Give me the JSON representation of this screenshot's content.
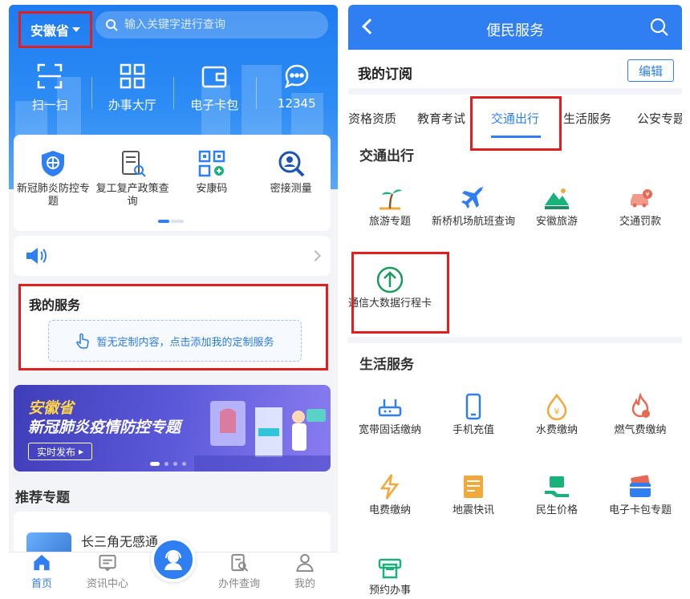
{
  "left": {
    "province": "安徽省",
    "search_placeholder": "输入关键字进行查询",
    "quick_actions": [
      {
        "label": "扫一扫",
        "icon": "scan-icon"
      },
      {
        "label": "办事大厅",
        "icon": "grid-icon"
      },
      {
        "label": "电子卡包",
        "icon": "wallet-icon"
      },
      {
        "label": "12345",
        "icon": "chat-icon"
      }
    ],
    "services": [
      {
        "label": "新冠肺炎防控专题",
        "icon": "shield-icon"
      },
      {
        "label": "复工复产政策查询",
        "icon": "document-icon"
      },
      {
        "label": "安康码",
        "icon": "qrcode-icon"
      },
      {
        "label": "密接测量",
        "icon": "magnifier-icon"
      }
    ],
    "my_service_title": "我的服务",
    "my_service_empty": "暂无定制内容，点击添加我的定制服务",
    "banner_line1": "安徽省",
    "banner_line2": "新冠肺炎疫情防控专题",
    "banner_button": "实时发布",
    "recommend_title": "推荐专题",
    "recommend_item": "长三角无感通",
    "tabs": [
      {
        "label": "首页",
        "active": true
      },
      {
        "label": "资讯中心",
        "active": false
      },
      {
        "label": "",
        "active": false
      },
      {
        "label": "办件查询",
        "active": false
      },
      {
        "label": "我的",
        "active": false
      }
    ],
    "colors": {
      "primary": "#2f7ff2",
      "highlight": "#e02020"
    }
  },
  "right": {
    "title": "便民服务",
    "subscription_label": "我的订阅",
    "edit_label": "编辑",
    "categories": [
      "资格资质",
      "教育考试",
      "交通出行",
      "生活服务",
      "公安专题"
    ],
    "selected_category": "交通出行",
    "traffic_section": "交通出行",
    "traffic_items": [
      {
        "label": "旅游专题",
        "icon": "palm-tree-icon"
      },
      {
        "label": "新桥机场航班查询",
        "icon": "airplane-icon"
      },
      {
        "label": "安徽旅游",
        "icon": "mountain-icon"
      },
      {
        "label": "交通罚款",
        "icon": "car-fine-icon"
      },
      {
        "label": "通信大数据行程卡",
        "icon": "arrow-up-circle-icon"
      }
    ],
    "life_section": "生活服务",
    "life_items": [
      {
        "label": "宽带固话缴纳",
        "icon": "router-icon"
      },
      {
        "label": "手机充值",
        "icon": "phone-icon"
      },
      {
        "label": "水费缴纳",
        "icon": "water-drop-icon"
      },
      {
        "label": "燃气费缴纳",
        "icon": "flame-icon"
      },
      {
        "label": "电费缴纳",
        "icon": "lightning-icon"
      },
      {
        "label": "地震快讯",
        "icon": "newspaper-icon"
      },
      {
        "label": "民生价格",
        "icon": "price-icon"
      },
      {
        "label": "电子卡包专题",
        "icon": "cards-icon"
      },
      {
        "label": "预约办事",
        "icon": "printer-icon"
      }
    ]
  }
}
